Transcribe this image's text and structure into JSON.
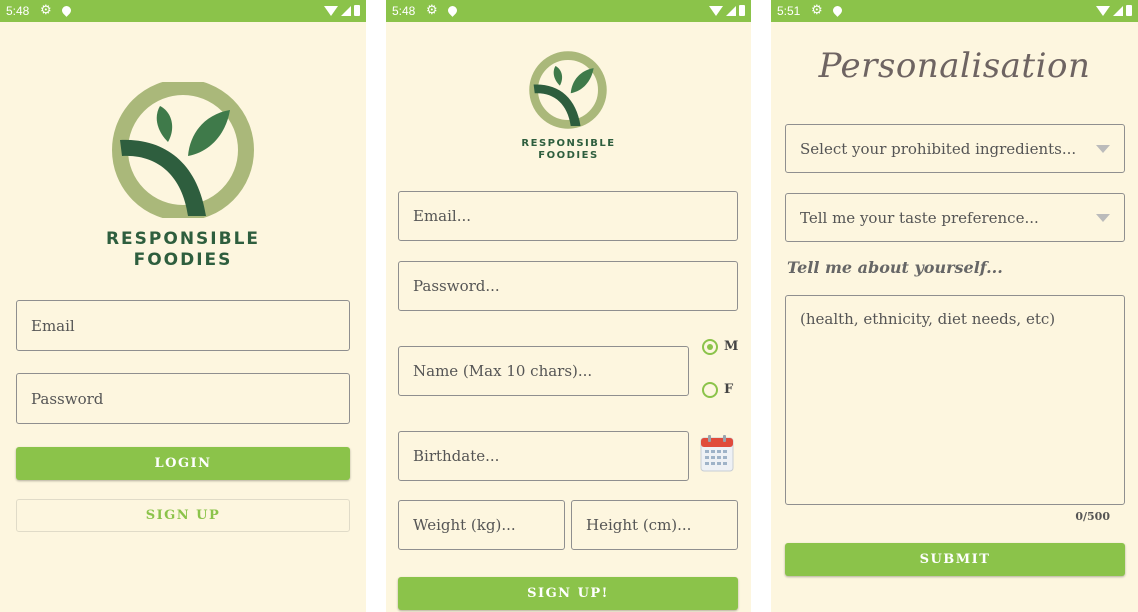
{
  "status_bar": [
    {
      "time": "5:48"
    },
    {
      "time": "5:48"
    },
    {
      "time": "5:51"
    }
  ],
  "brand": {
    "line1": "RESPONSIBLE",
    "line2": "FOODIES"
  },
  "colors": {
    "accent": "#8bc34a",
    "background": "#fdf6df",
    "logo_dark": "#2e5e3e",
    "logo_light": "#aab87a"
  },
  "login": {
    "email_placeholder": "Email",
    "password_placeholder": "Password",
    "login_label": "LOGIN",
    "signup_label": "SIGN UP"
  },
  "signup": {
    "email_placeholder": "Email...",
    "password_placeholder": "Password...",
    "name_placeholder": "Name (Max 10 chars)...",
    "gender_options": [
      "M",
      "F"
    ],
    "gender_selected": "M",
    "birthdate_placeholder": "Birthdate...",
    "weight_placeholder": "Weight (kg)...",
    "height_placeholder": "Height (cm)...",
    "submit_label": "SIGN UP!"
  },
  "personalisation": {
    "title": "Personalisation",
    "prohibited_placeholder": "Select your prohibited ingredients...",
    "taste_placeholder": "Tell me your taste preference...",
    "about_heading": "Tell me about yourself...",
    "about_placeholder": "(health, ethnicity, diet needs, etc)",
    "char_counter": "0/500",
    "submit_label": "SUBMIT"
  }
}
